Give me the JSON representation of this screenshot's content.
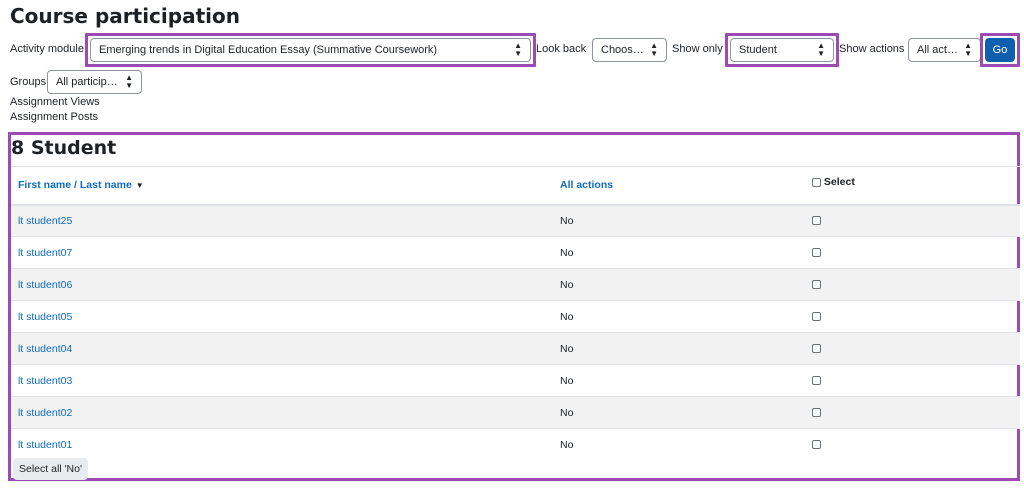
{
  "page_title": "Course participation",
  "filters": {
    "activity_module_label": "Activity module",
    "activity_module_value": "Emerging trends in Digital Education Essay (Summative Coursework)",
    "look_back_label": "Look back",
    "look_back_value": "Choose...",
    "show_only_label": "Show only",
    "show_only_value": "Student",
    "show_actions_label": "Show actions",
    "show_actions_value": "All actions",
    "go_label": "Go",
    "groups_label": "Groups",
    "groups_value": "All participants"
  },
  "info_lines": [
    "Assignment Views",
    "Assignment Posts"
  ],
  "report": {
    "heading": "8 Student",
    "columns": {
      "name": "First name / Last name",
      "actions": "All actions",
      "select": "Select"
    },
    "rows": [
      {
        "name": "lt student25",
        "actions": "No"
      },
      {
        "name": "lt student07",
        "actions": "No"
      },
      {
        "name": "lt student06",
        "actions": "No"
      },
      {
        "name": "lt student05",
        "actions": "No"
      },
      {
        "name": "lt student04",
        "actions": "No"
      },
      {
        "name": "lt student03",
        "actions": "No"
      },
      {
        "name": "lt student02",
        "actions": "No"
      },
      {
        "name": "lt student01",
        "actions": "No"
      }
    ],
    "select_all_label": "Select all 'No'"
  },
  "colors": {
    "highlight": "#9b4bb3",
    "link": "#0f6cbf",
    "primary_button": "#0f5fae"
  }
}
